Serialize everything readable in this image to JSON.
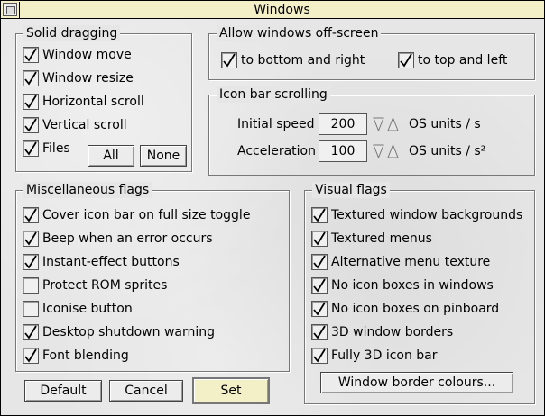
{
  "window": {
    "title": "Windows"
  },
  "solid_dragging": {
    "title": "Solid dragging",
    "options": [
      {
        "label": "Window move",
        "checked": true
      },
      {
        "label": "Window resize",
        "checked": true
      },
      {
        "label": "Horizontal scroll",
        "checked": true
      },
      {
        "label": "Vertical scroll",
        "checked": true
      },
      {
        "label": "Files",
        "checked": true
      }
    ],
    "all_label": "All",
    "none_label": "None"
  },
  "offscreen": {
    "title": "Allow windows off-screen",
    "bottom_right": {
      "label": "to bottom and right",
      "checked": true
    },
    "top_left": {
      "label": "to top and left",
      "checked": true
    }
  },
  "iconbar_scroll": {
    "title": "Icon bar scrolling",
    "initial_speed": {
      "label": "Initial speed",
      "value": "200",
      "unit": "OS units / s"
    },
    "acceleration": {
      "label": "Acceleration",
      "value": "100",
      "unit": "OS units / s²"
    }
  },
  "misc": {
    "title": "Miscellaneous flags",
    "options": [
      {
        "label": "Cover icon bar on full size toggle",
        "checked": true
      },
      {
        "label": "Beep when an error occurs",
        "checked": true
      },
      {
        "label": "Instant-effect buttons",
        "checked": true
      },
      {
        "label": "Protect ROM sprites",
        "checked": false
      },
      {
        "label": "Iconise button",
        "checked": false
      },
      {
        "label": "Desktop shutdown warning",
        "checked": true
      },
      {
        "label": "Font blending",
        "checked": true
      }
    ]
  },
  "visual": {
    "title": "Visual flags",
    "options": [
      {
        "label": "Textured window backgrounds",
        "checked": true
      },
      {
        "label": "Textured menus",
        "checked": true
      },
      {
        "label": "Alternative menu texture",
        "checked": true
      },
      {
        "label": "No icon boxes in windows",
        "checked": true
      },
      {
        "label": "No icon boxes on pinboard",
        "checked": true
      },
      {
        "label": "3D window borders",
        "checked": true
      },
      {
        "label": "Fully 3D icon bar",
        "checked": true
      }
    ],
    "border_colours_label": "Window border colours..."
  },
  "actions": {
    "default_label": "Default",
    "cancel_label": "Cancel",
    "set_label": "Set"
  }
}
